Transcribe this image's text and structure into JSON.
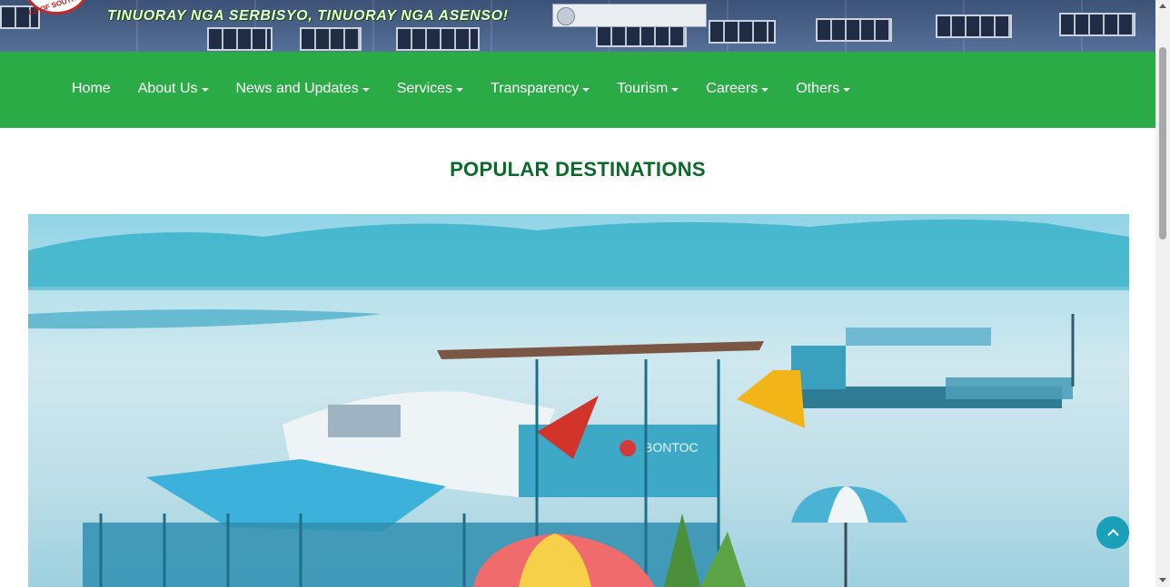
{
  "header": {
    "motto": "TINUORAY NGA SERBISYO, TINUORAY NGA ASENSO!",
    "logo_text": "CE OF SOUTHER"
  },
  "nav": {
    "items": [
      {
        "label": "Home",
        "dropdown": false
      },
      {
        "label": "About Us",
        "dropdown": true
      },
      {
        "label": "News and Updates",
        "dropdown": true
      },
      {
        "label": "Services",
        "dropdown": true
      },
      {
        "label": "Transparency",
        "dropdown": true
      },
      {
        "label": "Tourism",
        "dropdown": true
      },
      {
        "label": "Careers",
        "dropdown": true
      },
      {
        "label": "Others",
        "dropdown": true
      }
    ]
  },
  "main": {
    "heading": "POPULAR DESTINATIONS",
    "hero_sign_text": "BONTOC"
  },
  "colors": {
    "nav_bg": "#2aab45",
    "heading": "#0b6a2a",
    "back_to_top": "#1aa0b8"
  },
  "icons": {
    "back_to_top": "chevron-up-icon",
    "dropdown": "caret-down-icon"
  }
}
